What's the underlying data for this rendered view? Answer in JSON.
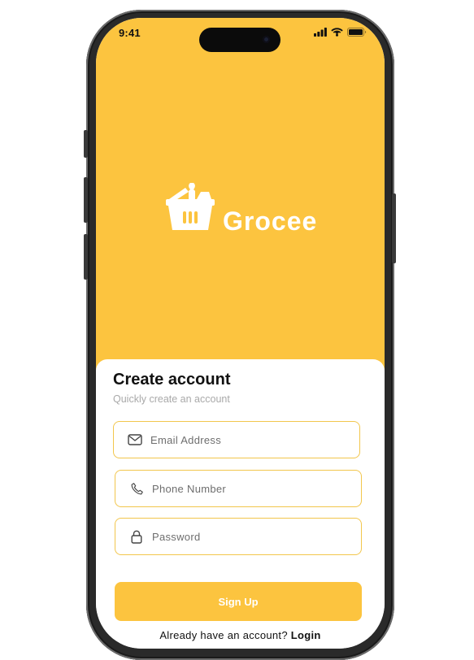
{
  "status_bar": {
    "time": "9:41"
  },
  "brand": {
    "name": "Grocee",
    "logo_icon": "basket-icon"
  },
  "form": {
    "title": "Create account",
    "subtitle": "Quickly create an account",
    "email": {
      "placeholder": "Email Address",
      "value": "",
      "icon": "mail-icon"
    },
    "phone": {
      "placeholder": "Phone Number",
      "value": "",
      "icon": "phone-icon"
    },
    "password": {
      "placeholder": "Password",
      "value": "",
      "icon": "lock-icon"
    },
    "submit_label": "Sign Up"
  },
  "footer": {
    "prompt": "Already have an account?",
    "login_label": "Login"
  },
  "colors": {
    "accent": "#fcc43f",
    "field_border": "#f2c64c",
    "hint": "#a9a9a9"
  }
}
